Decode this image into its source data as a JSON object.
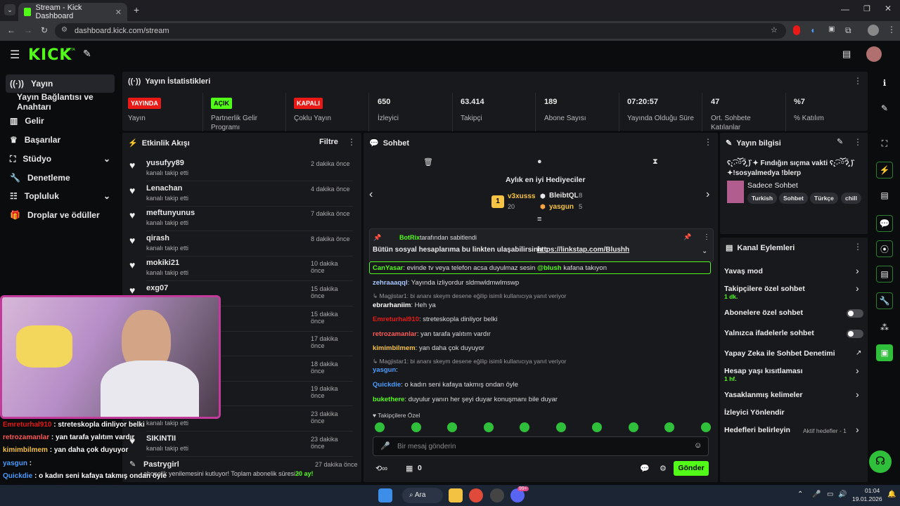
{
  "browser": {
    "tab_title": "Stream - Kick Dashboard",
    "url": "dashboard.kick.com/stream"
  },
  "kick": {
    "logo": "KICK",
    "beta": "BETA"
  },
  "sidebar": {
    "items": [
      {
        "label": "Yayın",
        "icon": "broadcast-icon"
      },
      {
        "label": "Yayın Bağlantısı ve Anahtarı",
        "icon": ""
      },
      {
        "label": "Gelir",
        "icon": "chart-icon"
      },
      {
        "label": "Başarılar",
        "icon": "trophy-icon"
      },
      {
        "label": "Stüdyo",
        "icon": "studio-icon"
      },
      {
        "label": "Denetleme",
        "icon": "wrench-icon"
      },
      {
        "label": "Topluluk",
        "icon": "community-icon"
      },
      {
        "label": "Droplar ve ödüller",
        "icon": "gift-icon"
      }
    ]
  },
  "stats": {
    "title": "Yayın İstatistikleri",
    "items": [
      {
        "value": "YAYINDA",
        "label": "Yayın",
        "color": "#e91916"
      },
      {
        "value": "AÇIK",
        "label": "Partnerlik Gelir Programı",
        "color": "#53fc18"
      },
      {
        "value": "KAPALI",
        "label": "Çoklu Yayın",
        "color": "#e91916"
      },
      {
        "value": "650",
        "label": "İzleyici"
      },
      {
        "value": "63.414",
        "label": "Takipçi"
      },
      {
        "value": "189",
        "label": "Abone Sayısı"
      },
      {
        "value": "07:20:57",
        "label": "Yayında Olduğu Süre"
      },
      {
        "value": "47",
        "label": "Ort. Sohbete Katılanlar"
      },
      {
        "value": "%7",
        "label": "% Katılım"
      }
    ]
  },
  "activity": {
    "title": "Etkinlik Akışı",
    "filter": "Filtre",
    "follow_text": "kanalı takip etti",
    "items": [
      {
        "name": "yusufyy89",
        "time": "2 dakika önce"
      },
      {
        "name": "Lenachan",
        "time": "4 dakika önce"
      },
      {
        "name": "meftunyunus",
        "time": "7 dakika önce"
      },
      {
        "name": "qirash",
        "time": "8 dakika önce"
      },
      {
        "name": "mokiki21",
        "time": "10 dakika önce"
      },
      {
        "name": "exg07",
        "time": "15 dakika önce"
      },
      {
        "name": "",
        "time": "15 dakika önce"
      },
      {
        "name": "",
        "time": "17 dakika önce"
      },
      {
        "name": "",
        "time": "18 dakika önce"
      },
      {
        "name": "",
        "time": "19 dakika önce"
      },
      {
        "name": "",
        "time": "23 dakika önce"
      },
      {
        "name": "SIKINTII",
        "time": "23 dakika önce"
      }
    ],
    "sub_name": "Pastrygirl",
    "sub_time": "27 dakika önce",
    "sub_text": "abonelik yenilemesini kutluyor! Toplam abonelik süresi -",
    "sub_months": "20 ay!"
  },
  "chat": {
    "title": "Sohbet",
    "gifters_title": "Aylık en iyi Hediyeciler",
    "gifters": [
      {
        "name": "v3xusss",
        "count": "20",
        "rank": "1"
      },
      {
        "name": "BleibtQL",
        "count": "8"
      },
      {
        "name": "yasgun",
        "count": "5"
      }
    ],
    "pinned_by": "BotRix",
    "pinned_suffix": "tarafından sabitlendi",
    "pinned_text": "Bütün sosyal hesaplarıma bu linkten ulaşabilirsiniz :",
    "pinned_link": "https://linkstap.com/Blushh",
    "messages": [
      {
        "user": "CanYasar",
        "color": "#53fc18",
        "text": "evinde tv veya telefon acsa duyulmaz sesin",
        "mention": "@blush",
        "rest": "kafana takıyon"
      },
      {
        "user": "zehraaaqql",
        "color": "#a8c8ff",
        "text": "Yayında izliyordur sldmwldmwlmswp"
      },
      {
        "reply": "Magjistar1: bi ananı skeym desene eğilip isimli kullanıcıya yanıt veriyor"
      },
      {
        "user": "ebrarhaniim",
        "color": "#ffffff",
        "text": "Heh ya"
      },
      {
        "user": "Emreturhal910",
        "color": "#e91916",
        "text": "streteskopla dinliyor belki"
      },
      {
        "user": "retrozamanlar",
        "color": "#ff5a5a",
        "text": "yan tarafa yalıtım vardır"
      },
      {
        "user": "kimimbilmem",
        "color": "#f6c343",
        "text": "yan daha çok duyuyor"
      },
      {
        "reply": "Magjistar1: bi ananı skeym desene eğilip isimli kullanıcıya yanıt veriyor"
      },
      {
        "user": "yasgun",
        "color": "#4a9eff",
        "text": ""
      },
      {
        "user": "Quickdie",
        "color": "#4a9eff",
        "text": "o kadın seni kafaya takmış ondan öyle"
      },
      {
        "user": "bukethere",
        "color": "#53fc18",
        "text": "duyulur yanın her şeyi duyar konuşmanı bile duyar"
      }
    ],
    "followers_only": "Takipçilere Özel",
    "placeholder": "Bir mesaj gönderin",
    "count": "0",
    "send": "Gönder"
  },
  "info": {
    "title": "Yayın bilgisi",
    "stream_title": "ʕ̢·͡˔·ོɁ̡̣̃ )̂ ✦ Fındığın sıçma vakti ʕ̢·͡˔·ོɁ̡̣̃ )̂ ✦!sosyalmedya !blerp",
    "category": "Sadece Sohbet",
    "tags": [
      "Turkish",
      "Sohbet",
      "Türkçe",
      "chill"
    ]
  },
  "actions": {
    "title": "Kanal Eylemleri",
    "items": [
      {
        "label": "Yavaş mod",
        "type": "chev"
      },
      {
        "label": "Takipçilere özel sohbet",
        "sub": "1 dk.",
        "type": "chev"
      },
      {
        "label": "Abonelere özel sohbet",
        "type": "toggle"
      },
      {
        "label": "Yalnızca ifadelerle sohbet",
        "type": "toggle"
      },
      {
        "label": "Yapay Zeka ile Sohbet Denetimi",
        "type": "ext"
      },
      {
        "label": "Hesap yaşı kısıtlaması",
        "sub": "1 hf.",
        "type": "chev"
      },
      {
        "label": "Yasaklanmış kelimeler",
        "type": "chev"
      },
      {
        "label": "İzleyici Yönlendir",
        "type": "none"
      },
      {
        "label": "Hedefleri belirleyin",
        "note": "Aktif hedefler - 1",
        "type": "chev"
      }
    ]
  },
  "overlay": {
    "lines": [
      {
        "user": "Emreturhal910",
        "color": "#e91916",
        "text": "streteskopla dinliyor belki"
      },
      {
        "user": "retrozamanlar",
        "color": "#ff5a5a",
        "text": "yan tarafa yalıtım vardır"
      },
      {
        "user": "kimimbilmem",
        "color": "#f6c343",
        "text": "yan daha çok duyuyor"
      },
      {
        "user": "yasgun",
        "color": "#4a9eff",
        "text": ""
      },
      {
        "user": "Quickdie",
        "color": "#4a9eff",
        "text": "o kadın seni kafaya takmış ondan öyle"
      },
      {
        "user": "bukethere",
        "color": "#53fc18",
        "text": "duyulur yanın her şeyi duyar"
      }
    ],
    "line7": "konuşmanı bile duyar"
  },
  "taskbar": {
    "search": "Ara",
    "time": "01:04",
    "date": "19.01.2026",
    "badge": "99+"
  }
}
